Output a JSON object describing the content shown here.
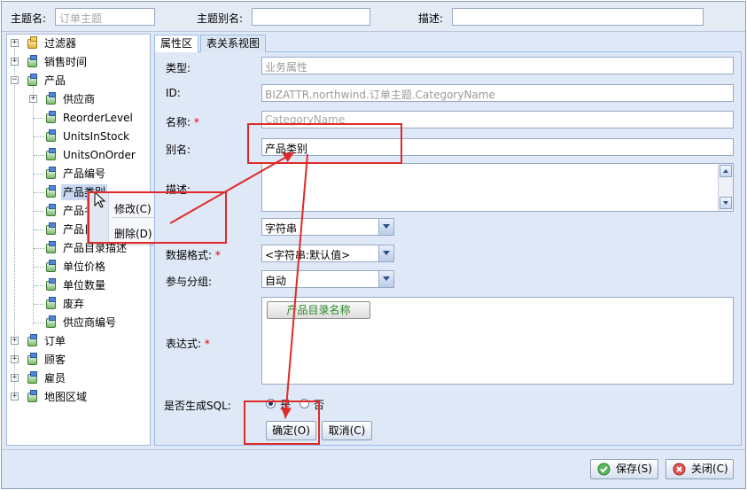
{
  "header": {
    "subject_name_label": "主题名:",
    "subject_name_placeholder": "订单主题",
    "subject_alias_label": "主题别名:",
    "subject_alias_value": "",
    "description_label": "描述:",
    "description_value": ""
  },
  "tree": {
    "items": [
      {
        "label": "过滤器",
        "icon": "filter-icon"
      },
      {
        "label": "销售时间",
        "icon": "field-icon"
      },
      {
        "label": "产品",
        "icon": "field-icon"
      },
      {
        "label": "供应商",
        "icon": "field-icon"
      },
      {
        "label": "ReorderLevel",
        "icon": "field-icon"
      },
      {
        "label": "UnitsInStock",
        "icon": "field-icon"
      },
      {
        "label": "UnitsOnOrder",
        "icon": "field-icon"
      },
      {
        "label": "产品编号",
        "icon": "field-icon"
      },
      {
        "label": "产品类别",
        "icon": "field-icon"
      },
      {
        "label": "产品名",
        "icon": "field-icon"
      },
      {
        "label": "产品目录",
        "icon": "field-icon"
      },
      {
        "label": "产品目录描述",
        "icon": "field-icon"
      },
      {
        "label": "单位价格",
        "icon": "field-icon"
      },
      {
        "label": "单位数量",
        "icon": "field-icon"
      },
      {
        "label": "废弃",
        "icon": "field-icon"
      },
      {
        "label": "供应商编号",
        "icon": "field-icon"
      },
      {
        "label": "订单",
        "icon": "field-icon"
      },
      {
        "label": "顾客",
        "icon": "field-icon"
      },
      {
        "label": "雇员",
        "icon": "field-icon"
      },
      {
        "label": "地图区域",
        "icon": "field-icon"
      }
    ]
  },
  "context_menu": {
    "items": [
      {
        "label": "修改(C)"
      },
      {
        "label": "删除(D)"
      }
    ]
  },
  "tabs": [
    {
      "label": "属性区",
      "active": true
    },
    {
      "label": "表关系视图",
      "active": false
    }
  ],
  "form": {
    "type_label": "类型:",
    "type_value": "业务属性",
    "id_label": "ID:",
    "id_value": "BIZATTR.northwind.订单主题.CategoryName",
    "name_label": "名称:",
    "name_placeholder": "CategoryName",
    "alias_label": "别名:",
    "alias_value": "产品类别",
    "desc_label": "描述:",
    "datatype_value": "字符串",
    "format_label": "数据格式:",
    "format_value": "<字符串:默认值>",
    "group_label": "参与分组:",
    "group_value": "自动",
    "expr_label": "表达式:",
    "expr_chip": "产品目录名称",
    "sql_label": "是否生成SQL:",
    "sql_yes": "是",
    "sql_no": "否",
    "required_mark": "*"
  },
  "form_buttons": {
    "ok": "确定(O)",
    "cancel": "取消(C)"
  },
  "footer": {
    "save": "保存(S)",
    "close": "关闭(C)"
  },
  "colors": {
    "annotation_red": "#e02a2a",
    "panel_bg": "#dfe8f6",
    "chip_text": "#2b8a2b"
  }
}
